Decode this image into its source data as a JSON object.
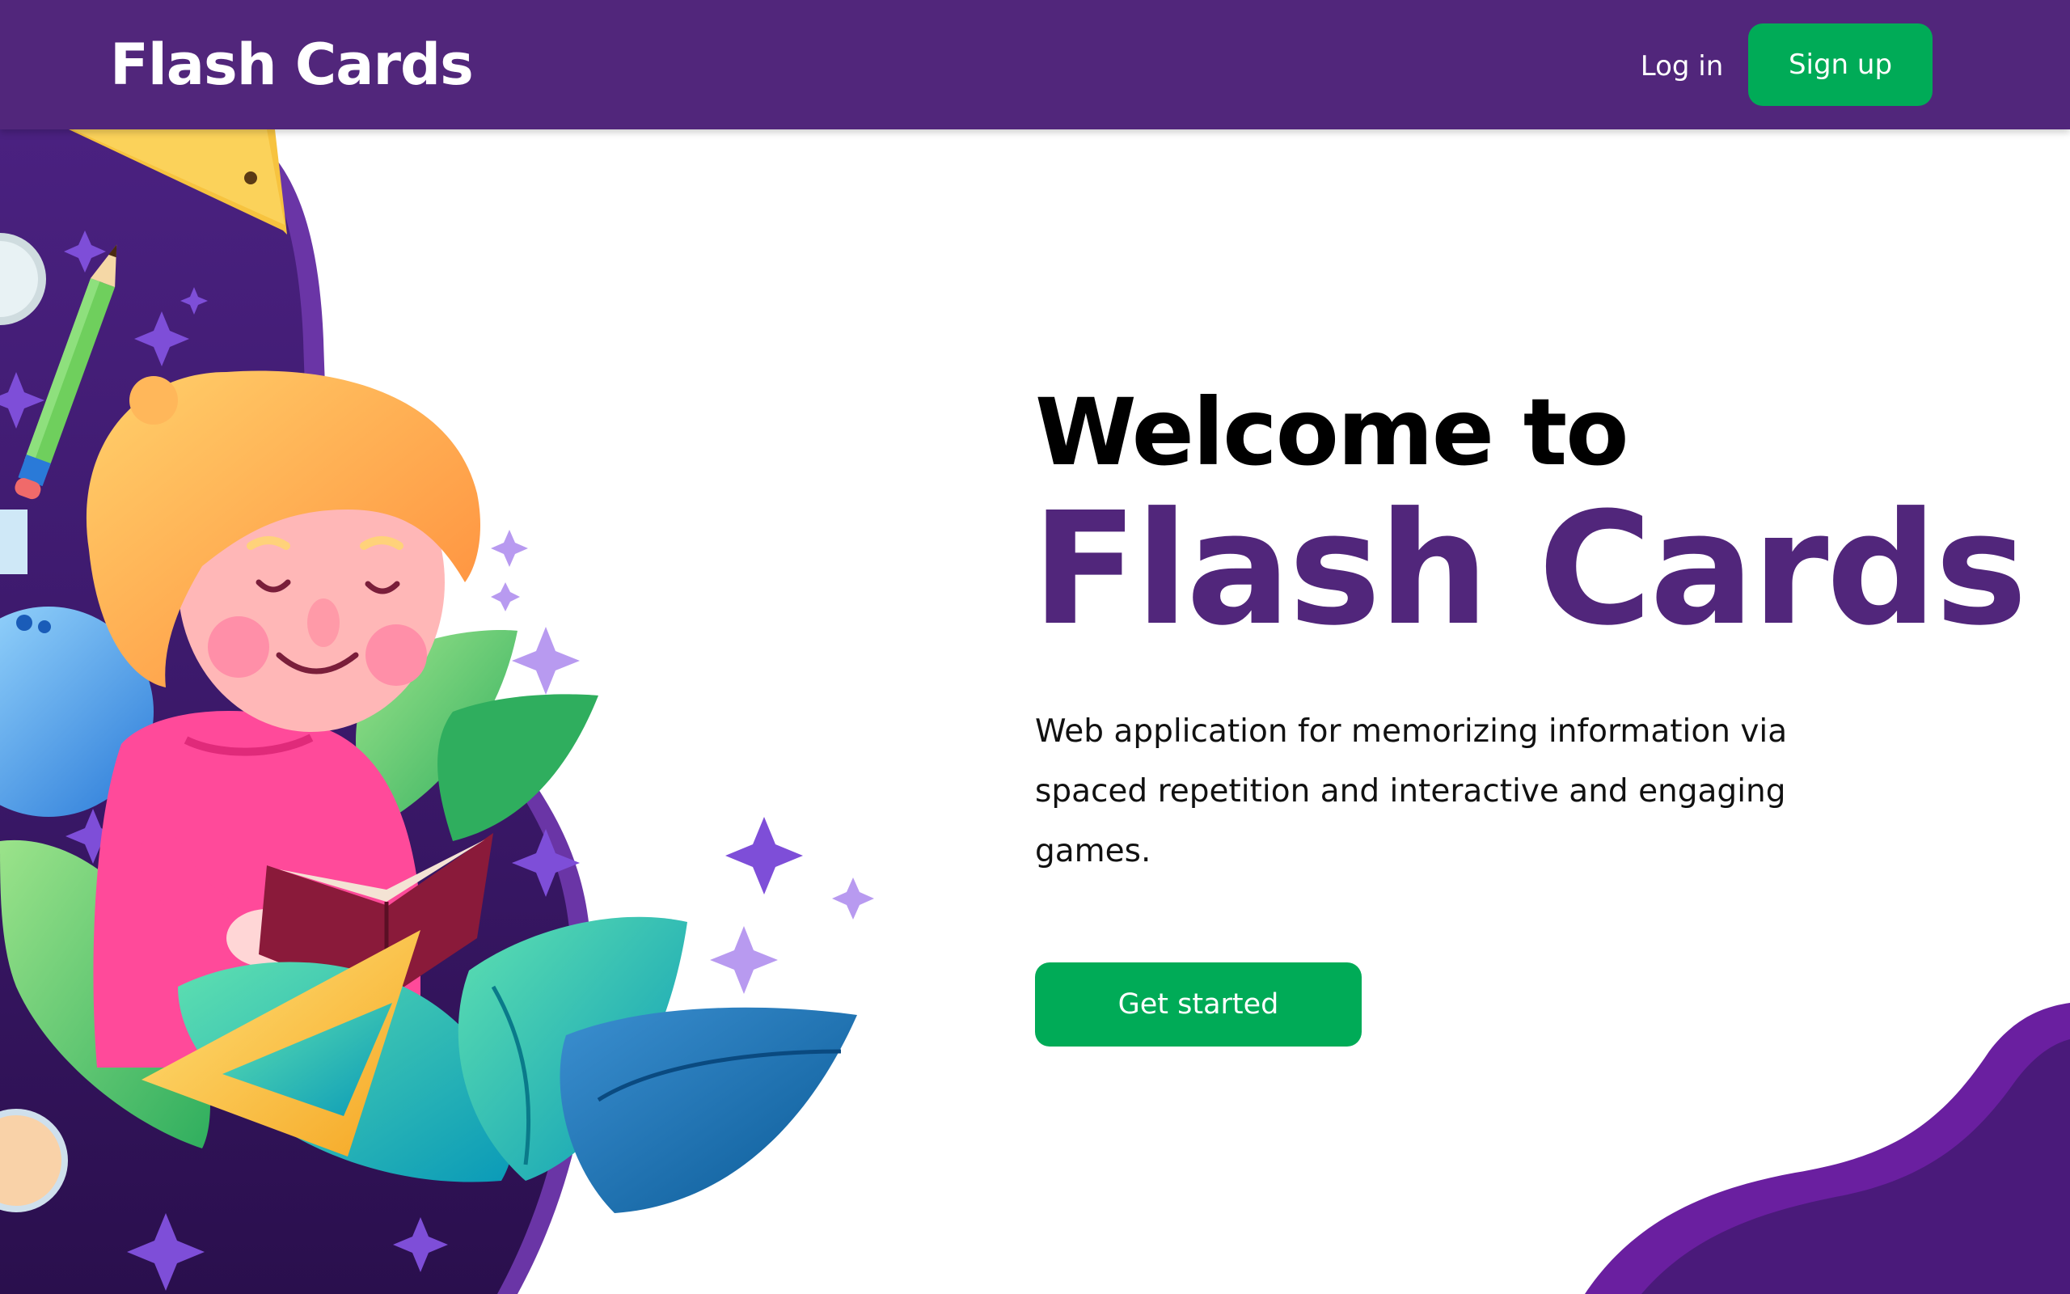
{
  "header": {
    "brand": "Flash Cards",
    "login_label": "Log in",
    "signup_label": "Sign up"
  },
  "hero": {
    "welcome": "Welcome to",
    "title": "Flash Cards",
    "description": "Web application for memorizing information via spaced repetition and interactive and engaging games.",
    "cta_label": "Get started"
  },
  "colors": {
    "brand_purple": "#51267b",
    "deep_purple": "#2d1452",
    "accent_green": "#00ab57",
    "text": "#000000"
  },
  "illustration": {
    "subject": "child-reading-book-illustration",
    "elements": [
      "pencil-icon",
      "ruler-icon",
      "triangle-ruler-icon",
      "flask-icon",
      "magnifier-icon",
      "leaf-icon",
      "sparkle-icon",
      "book-icon"
    ]
  }
}
